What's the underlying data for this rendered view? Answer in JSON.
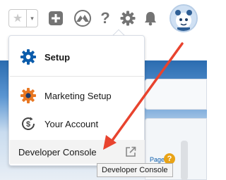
{
  "header": {
    "favorites_star": "★",
    "favorites_dropdown": "▾",
    "help_icon_glyph": "?"
  },
  "menu": {
    "items": [
      {
        "label": "Setup",
        "icon": "gear-icon"
      },
      {
        "label": "Marketing Setup",
        "icon": "marketing-gear-icon"
      },
      {
        "label": "Your Account",
        "icon": "dollar-circle-icon"
      },
      {
        "label": "Developer Console",
        "icon": "external-link-icon"
      }
    ]
  },
  "tooltip": {
    "text": "Developer Console"
  },
  "background": {
    "page_link": "Page",
    "help_glyph": "?"
  },
  "colors": {
    "setup_icon": "#0b5cab",
    "marketing_icon": "#e87722",
    "annotation_arrow": "#e8432e",
    "header_icons": "#747474"
  }
}
